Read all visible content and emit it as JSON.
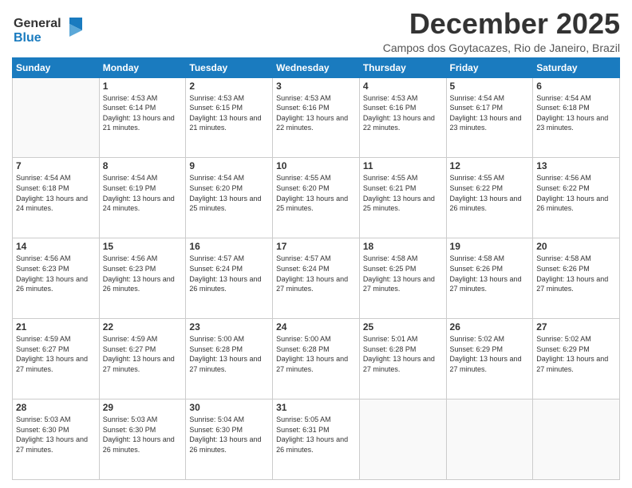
{
  "logo": {
    "line1": "General",
    "line2": "Blue"
  },
  "title": "December 2025",
  "location": "Campos dos Goytacazes, Rio de Janeiro, Brazil",
  "days_of_week": [
    "Sunday",
    "Monday",
    "Tuesday",
    "Wednesday",
    "Thursday",
    "Friday",
    "Saturday"
  ],
  "weeks": [
    [
      {
        "day": "",
        "empty": true
      },
      {
        "day": "1",
        "sunrise": "Sunrise: 4:53 AM",
        "sunset": "Sunset: 6:14 PM",
        "daylight": "Daylight: 13 hours and 21 minutes."
      },
      {
        "day": "2",
        "sunrise": "Sunrise: 4:53 AM",
        "sunset": "Sunset: 6:15 PM",
        "daylight": "Daylight: 13 hours and 21 minutes."
      },
      {
        "day": "3",
        "sunrise": "Sunrise: 4:53 AM",
        "sunset": "Sunset: 6:16 PM",
        "daylight": "Daylight: 13 hours and 22 minutes."
      },
      {
        "day": "4",
        "sunrise": "Sunrise: 4:53 AM",
        "sunset": "Sunset: 6:16 PM",
        "daylight": "Daylight: 13 hours and 22 minutes."
      },
      {
        "day": "5",
        "sunrise": "Sunrise: 4:54 AM",
        "sunset": "Sunset: 6:17 PM",
        "daylight": "Daylight: 13 hours and 23 minutes."
      },
      {
        "day": "6",
        "sunrise": "Sunrise: 4:54 AM",
        "sunset": "Sunset: 6:18 PM",
        "daylight": "Daylight: 13 hours and 23 minutes."
      }
    ],
    [
      {
        "day": "7",
        "sunrise": "Sunrise: 4:54 AM",
        "sunset": "Sunset: 6:18 PM",
        "daylight": "Daylight: 13 hours and 24 minutes."
      },
      {
        "day": "8",
        "sunrise": "Sunrise: 4:54 AM",
        "sunset": "Sunset: 6:19 PM",
        "daylight": "Daylight: 13 hours and 24 minutes."
      },
      {
        "day": "9",
        "sunrise": "Sunrise: 4:54 AM",
        "sunset": "Sunset: 6:20 PM",
        "daylight": "Daylight: 13 hours and 25 minutes."
      },
      {
        "day": "10",
        "sunrise": "Sunrise: 4:55 AM",
        "sunset": "Sunset: 6:20 PM",
        "daylight": "Daylight: 13 hours and 25 minutes."
      },
      {
        "day": "11",
        "sunrise": "Sunrise: 4:55 AM",
        "sunset": "Sunset: 6:21 PM",
        "daylight": "Daylight: 13 hours and 25 minutes."
      },
      {
        "day": "12",
        "sunrise": "Sunrise: 4:55 AM",
        "sunset": "Sunset: 6:22 PM",
        "daylight": "Daylight: 13 hours and 26 minutes."
      },
      {
        "day": "13",
        "sunrise": "Sunrise: 4:56 AM",
        "sunset": "Sunset: 6:22 PM",
        "daylight": "Daylight: 13 hours and 26 minutes."
      }
    ],
    [
      {
        "day": "14",
        "sunrise": "Sunrise: 4:56 AM",
        "sunset": "Sunset: 6:23 PM",
        "daylight": "Daylight: 13 hours and 26 minutes."
      },
      {
        "day": "15",
        "sunrise": "Sunrise: 4:56 AM",
        "sunset": "Sunset: 6:23 PM",
        "daylight": "Daylight: 13 hours and 26 minutes."
      },
      {
        "day": "16",
        "sunrise": "Sunrise: 4:57 AM",
        "sunset": "Sunset: 6:24 PM",
        "daylight": "Daylight: 13 hours and 26 minutes."
      },
      {
        "day": "17",
        "sunrise": "Sunrise: 4:57 AM",
        "sunset": "Sunset: 6:24 PM",
        "daylight": "Daylight: 13 hours and 27 minutes."
      },
      {
        "day": "18",
        "sunrise": "Sunrise: 4:58 AM",
        "sunset": "Sunset: 6:25 PM",
        "daylight": "Daylight: 13 hours and 27 minutes."
      },
      {
        "day": "19",
        "sunrise": "Sunrise: 4:58 AM",
        "sunset": "Sunset: 6:26 PM",
        "daylight": "Daylight: 13 hours and 27 minutes."
      },
      {
        "day": "20",
        "sunrise": "Sunrise: 4:58 AM",
        "sunset": "Sunset: 6:26 PM",
        "daylight": "Daylight: 13 hours and 27 minutes."
      }
    ],
    [
      {
        "day": "21",
        "sunrise": "Sunrise: 4:59 AM",
        "sunset": "Sunset: 6:27 PM",
        "daylight": "Daylight: 13 hours and 27 minutes."
      },
      {
        "day": "22",
        "sunrise": "Sunrise: 4:59 AM",
        "sunset": "Sunset: 6:27 PM",
        "daylight": "Daylight: 13 hours and 27 minutes."
      },
      {
        "day": "23",
        "sunrise": "Sunrise: 5:00 AM",
        "sunset": "Sunset: 6:28 PM",
        "daylight": "Daylight: 13 hours and 27 minutes."
      },
      {
        "day": "24",
        "sunrise": "Sunrise: 5:00 AM",
        "sunset": "Sunset: 6:28 PM",
        "daylight": "Daylight: 13 hours and 27 minutes."
      },
      {
        "day": "25",
        "sunrise": "Sunrise: 5:01 AM",
        "sunset": "Sunset: 6:28 PM",
        "daylight": "Daylight: 13 hours and 27 minutes."
      },
      {
        "day": "26",
        "sunrise": "Sunrise: 5:02 AM",
        "sunset": "Sunset: 6:29 PM",
        "daylight": "Daylight: 13 hours and 27 minutes."
      },
      {
        "day": "27",
        "sunrise": "Sunrise: 5:02 AM",
        "sunset": "Sunset: 6:29 PM",
        "daylight": "Daylight: 13 hours and 27 minutes."
      }
    ],
    [
      {
        "day": "28",
        "sunrise": "Sunrise: 5:03 AM",
        "sunset": "Sunset: 6:30 PM",
        "daylight": "Daylight: 13 hours and 27 minutes."
      },
      {
        "day": "29",
        "sunrise": "Sunrise: 5:03 AM",
        "sunset": "Sunset: 6:30 PM",
        "daylight": "Daylight: 13 hours and 26 minutes."
      },
      {
        "day": "30",
        "sunrise": "Sunrise: 5:04 AM",
        "sunset": "Sunset: 6:30 PM",
        "daylight": "Daylight: 13 hours and 26 minutes."
      },
      {
        "day": "31",
        "sunrise": "Sunrise: 5:05 AM",
        "sunset": "Sunset: 6:31 PM",
        "daylight": "Daylight: 13 hours and 26 minutes."
      },
      {
        "day": "",
        "empty": true
      },
      {
        "day": "",
        "empty": true
      },
      {
        "day": "",
        "empty": true
      }
    ]
  ]
}
